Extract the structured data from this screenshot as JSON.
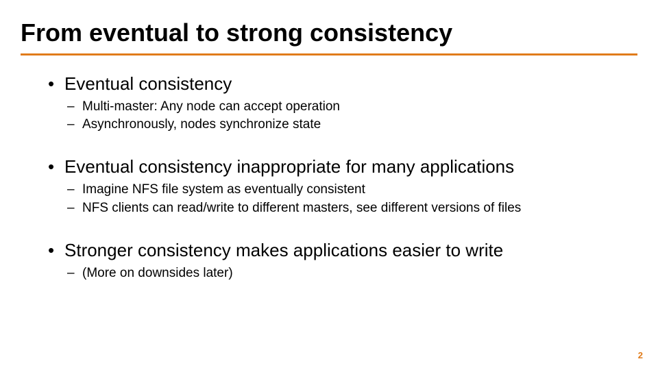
{
  "title": "From eventual to strong consistency",
  "bullets": [
    {
      "text": "Eventual consistency",
      "sub": [
        "Multi-master:  Any node can accept operation",
        "Asynchronously, nodes synchronize state"
      ]
    },
    {
      "text": "Eventual consistency inappropriate for many applications",
      "sub": [
        "Imagine NFS file system as eventually consistent",
        "NFS clients can read/write to different masters, see different versions of files"
      ]
    },
    {
      "text": "Stronger consistency makes applications easier to write",
      "sub": [
        "(More on downsides later)"
      ]
    }
  ],
  "pageNumber": "2"
}
